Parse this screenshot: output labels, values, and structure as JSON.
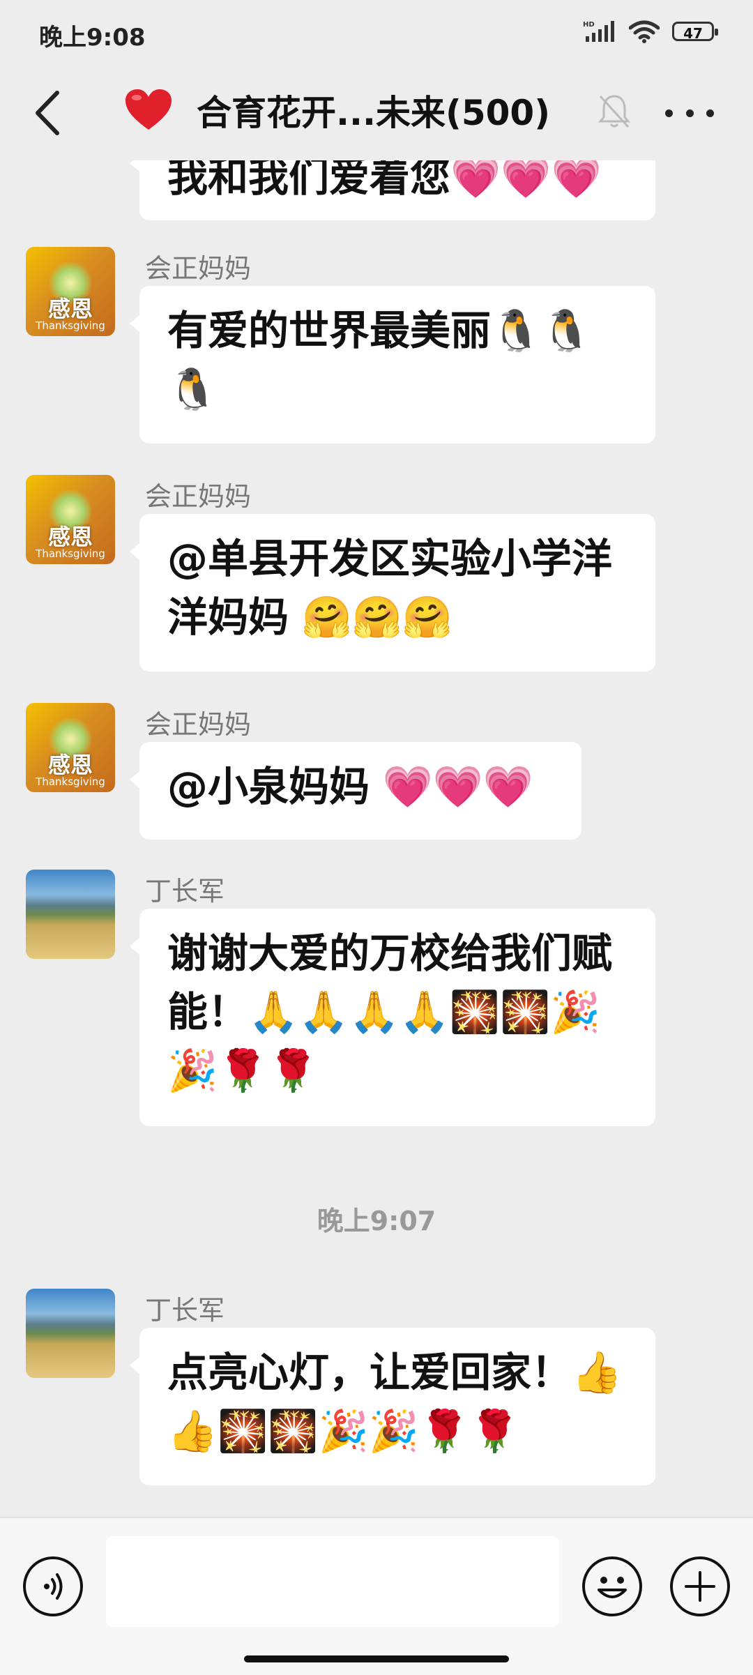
{
  "status_bar": {
    "time": "晚上9:08",
    "battery": "47"
  },
  "header": {
    "title_emoji": "❤️",
    "title": "合育花开...未来(500)"
  },
  "messages": [
    {
      "sender": "",
      "avatar": "landscape",
      "text": "我和我们爱着您",
      "emojis": "💗💗💗",
      "partial": true
    },
    {
      "sender": "会正妈妈",
      "avatar": "gratitude",
      "text": "有爱的世界最美丽",
      "emojis": "🐧🐧🐧"
    },
    {
      "sender": "会正妈妈",
      "avatar": "gratitude",
      "text": "@单县开发区实验小学洋洋妈妈",
      "emojis": " 🤗🤗🤗"
    },
    {
      "sender": "会正妈妈",
      "avatar": "gratitude",
      "text": "@小泉妈妈",
      "emojis": " 💗💗💗"
    },
    {
      "sender": "丁长军",
      "avatar": "landscape",
      "text": "谢谢大爱的万校给我们赋能！",
      "emojis": "🙏🙏🙏🙏🎇🎇🎉🎉🌹🌹"
    },
    {
      "divider": "晚上9:07"
    },
    {
      "sender": "丁长军",
      "avatar": "landscape",
      "text": "点亮心灯，让爱回家！",
      "emojis": "👍👍🎇🎇🎉🎉🌹🌹"
    }
  ],
  "avatar_gratitude": {
    "cn": "感恩",
    "en": "Thanksgiving"
  },
  "input": {
    "placeholder": ""
  },
  "colors": {
    "background": "#ededed",
    "bubble": "#ffffff",
    "sender": "#777777"
  }
}
